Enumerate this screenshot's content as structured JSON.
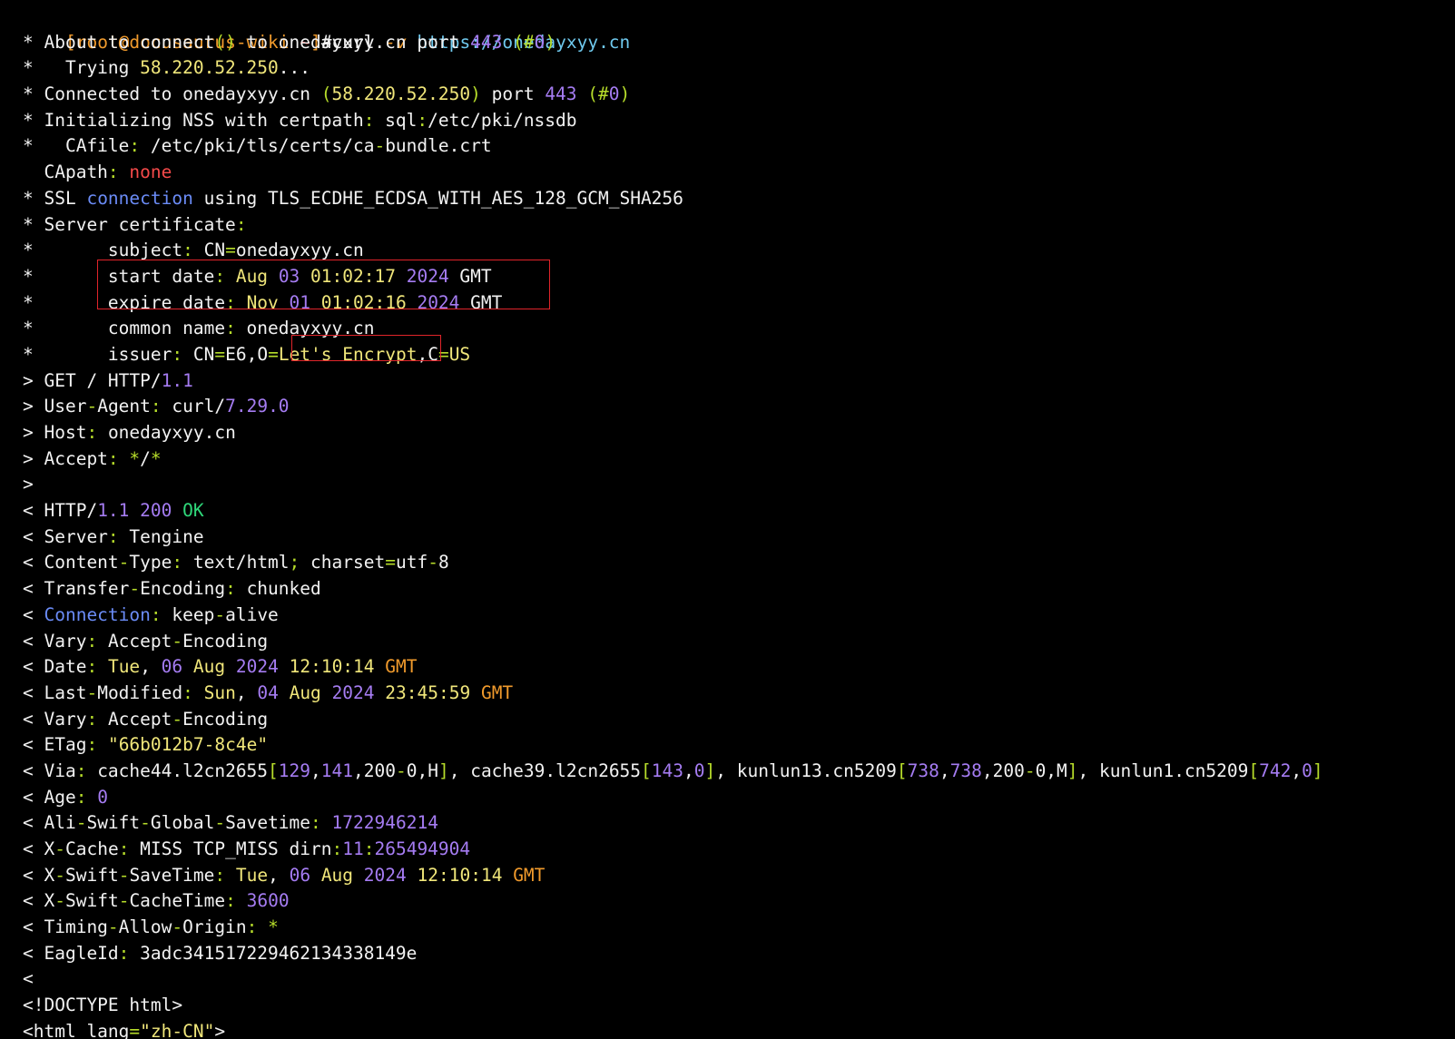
{
  "terminal": {
    "prompt": {
      "open_bracket": "[",
      "user_host": "root@docusaurus-wiki",
      "cwd": "~",
      "close_bracket": "]",
      "symbol": "#"
    },
    "command": {
      "name": "curl",
      "flag": "-v",
      "url": "https://onedayxyy.cn"
    },
    "colors": {
      "default": "#f2f2f2",
      "punctuation": "#b6dc2a",
      "number": "#a57cf2",
      "string": "#f0e67a",
      "keyword_red": "#f54a4a",
      "timezone": "#f09a2c",
      "url": "#6fc9ee",
      "keyword_blue": "#6b8cf7",
      "status_ok": "#2fd87a",
      "highlight_box": "#e0242a"
    },
    "lines": [
      [
        [
          "c-w",
          "* About to connect"
        ],
        [
          "c-g",
          "()"
        ],
        [
          "c-w",
          " to onedayxyy.cn port "
        ],
        [
          "c-p",
          "443"
        ],
        [
          "c-w",
          " "
        ],
        [
          "c-g",
          "(#"
        ],
        [
          "c-p",
          "0"
        ],
        [
          "c-g",
          ")"
        ]
      ],
      [
        [
          "c-w",
          "*   Trying "
        ],
        [
          "c-y",
          "58.220.52.250"
        ],
        [
          "c-w",
          "..."
        ]
      ],
      [
        [
          "c-w",
          "* Connected to onedayxyy.cn "
        ],
        [
          "c-g",
          "("
        ],
        [
          "c-y",
          "58.220.52.250"
        ],
        [
          "c-g",
          ")"
        ],
        [
          "c-w",
          " port "
        ],
        [
          "c-p",
          "443"
        ],
        [
          "c-w",
          " "
        ],
        [
          "c-g",
          "(#"
        ],
        [
          "c-p",
          "0"
        ],
        [
          "c-g",
          ")"
        ]
      ],
      [
        [
          "c-w",
          "* Initializing NSS with certpath"
        ],
        [
          "c-g",
          ":"
        ],
        [
          "c-w",
          " sql"
        ],
        [
          "c-g",
          ":"
        ],
        [
          "c-w",
          "/etc/pki/nssdb"
        ]
      ],
      [
        [
          "c-w",
          "*   CAfile"
        ],
        [
          "c-g",
          ":"
        ],
        [
          "c-w",
          " /etc/pki/tls/certs/ca"
        ],
        [
          "c-g",
          "-"
        ],
        [
          "c-w",
          "bundle.crt"
        ]
      ],
      [
        [
          "c-w",
          "  CApath"
        ],
        [
          "c-g",
          ":"
        ],
        [
          "c-w",
          " "
        ],
        [
          "c-r",
          "none"
        ]
      ],
      [
        [
          "c-w",
          "* SSL "
        ],
        [
          "c-b",
          "connection"
        ],
        [
          "c-w",
          " using TLS_ECDHE_ECDSA_WITH_AES_128_GCM_SHA256"
        ]
      ],
      [
        [
          "c-w",
          "* Server certificate"
        ],
        [
          "c-g",
          ":"
        ]
      ],
      [
        [
          "c-w",
          "*       subject"
        ],
        [
          "c-g",
          ":"
        ],
        [
          "c-w",
          " CN"
        ],
        [
          "c-g",
          "="
        ],
        [
          "c-w",
          "onedayxyy.cn"
        ]
      ],
      [
        [
          "c-w",
          "*       start date"
        ],
        [
          "c-g",
          ":"
        ],
        [
          "c-w",
          " "
        ],
        [
          "c-y",
          "Aug"
        ],
        [
          "c-w",
          " "
        ],
        [
          "c-p",
          "03"
        ],
        [
          "c-w",
          " "
        ],
        [
          "c-y",
          "01:02:17"
        ],
        [
          "c-w",
          " "
        ],
        [
          "c-p",
          "2024"
        ],
        [
          "c-w",
          " GMT"
        ]
      ],
      [
        [
          "c-w",
          "*       expire date"
        ],
        [
          "c-g",
          ":"
        ],
        [
          "c-w",
          " "
        ],
        [
          "c-y",
          "Nov"
        ],
        [
          "c-w",
          " "
        ],
        [
          "c-p",
          "01"
        ],
        [
          "c-w",
          " "
        ],
        [
          "c-y",
          "01:02:16"
        ],
        [
          "c-w",
          " "
        ],
        [
          "c-p",
          "2024"
        ],
        [
          "c-w",
          " GMT"
        ]
      ],
      [
        [
          "c-w",
          "*       common name"
        ],
        [
          "c-g",
          ":"
        ],
        [
          "c-w",
          " onedayxyy.cn"
        ]
      ],
      [
        [
          "c-w",
          "*       issuer"
        ],
        [
          "c-g",
          ":"
        ],
        [
          "c-w",
          " CN"
        ],
        [
          "c-g",
          "="
        ],
        [
          "c-w",
          "E6,O"
        ],
        [
          "c-g",
          "="
        ],
        [
          "c-y",
          "Let's Encrypt"
        ],
        [
          "c-w",
          ",C"
        ],
        [
          "c-g",
          "="
        ],
        [
          "c-y",
          "US"
        ]
      ],
      [
        [
          "c-w",
          "> GET / HTTP/"
        ],
        [
          "c-p",
          "1.1"
        ]
      ],
      [
        [
          "c-w",
          "> User"
        ],
        [
          "c-g",
          "-"
        ],
        [
          "c-w",
          "Agent"
        ],
        [
          "c-g",
          ":"
        ],
        [
          "c-w",
          " curl/"
        ],
        [
          "c-p",
          "7.29.0"
        ]
      ],
      [
        [
          "c-w",
          "> Host"
        ],
        [
          "c-g",
          ":"
        ],
        [
          "c-w",
          " onedayxyy.cn"
        ]
      ],
      [
        [
          "c-w",
          "> Accept"
        ],
        [
          "c-g",
          ":"
        ],
        [
          "c-w",
          " "
        ],
        [
          "c-g",
          "*"
        ],
        [
          "c-w",
          "/"
        ],
        [
          "c-g",
          "*"
        ]
      ],
      [
        [
          "c-w",
          ">"
        ]
      ],
      [
        [
          "c-w",
          "< HTTP/"
        ],
        [
          "c-p",
          "1.1"
        ],
        [
          "c-w",
          " "
        ],
        [
          "c-p",
          "200"
        ],
        [
          "c-w",
          " "
        ],
        [
          "c-n",
          "OK"
        ]
      ],
      [
        [
          "c-w",
          "< Server"
        ],
        [
          "c-g",
          ":"
        ],
        [
          "c-w",
          " Tengine"
        ]
      ],
      [
        [
          "c-w",
          "< Content"
        ],
        [
          "c-g",
          "-"
        ],
        [
          "c-w",
          "Type"
        ],
        [
          "c-g",
          ":"
        ],
        [
          "c-w",
          " text/html"
        ],
        [
          "c-g",
          ";"
        ],
        [
          "c-w",
          " charset"
        ],
        [
          "c-g",
          "="
        ],
        [
          "c-w",
          "utf"
        ],
        [
          "c-g",
          "-"
        ],
        [
          "c-w",
          "8"
        ]
      ],
      [
        [
          "c-w",
          "< Transfer"
        ],
        [
          "c-g",
          "-"
        ],
        [
          "c-w",
          "Encoding"
        ],
        [
          "c-g",
          ":"
        ],
        [
          "c-w",
          " chunked"
        ]
      ],
      [
        [
          "c-w",
          "< "
        ],
        [
          "c-b",
          "Connection"
        ],
        [
          "c-g",
          ":"
        ],
        [
          "c-w",
          " keep"
        ],
        [
          "c-g",
          "-"
        ],
        [
          "c-w",
          "alive"
        ]
      ],
      [
        [
          "c-w",
          "< Vary"
        ],
        [
          "c-g",
          ":"
        ],
        [
          "c-w",
          " Accept"
        ],
        [
          "c-g",
          "-"
        ],
        [
          "c-w",
          "Encoding"
        ]
      ],
      [
        [
          "c-w",
          "< Date"
        ],
        [
          "c-g",
          ":"
        ],
        [
          "c-w",
          " "
        ],
        [
          "c-y",
          "Tue"
        ],
        [
          "c-w",
          ", "
        ],
        [
          "c-p",
          "06"
        ],
        [
          "c-w",
          " "
        ],
        [
          "c-y",
          "Aug"
        ],
        [
          "c-w",
          " "
        ],
        [
          "c-p",
          "2024"
        ],
        [
          "c-w",
          " "
        ],
        [
          "c-y",
          "12:10:14"
        ],
        [
          "c-w",
          " "
        ],
        [
          "c-o",
          "GMT"
        ]
      ],
      [
        [
          "c-w",
          "< Last"
        ],
        [
          "c-g",
          "-"
        ],
        [
          "c-w",
          "Modified"
        ],
        [
          "c-g",
          ":"
        ],
        [
          "c-w",
          " "
        ],
        [
          "c-y",
          "Sun"
        ],
        [
          "c-w",
          ", "
        ],
        [
          "c-p",
          "04"
        ],
        [
          "c-w",
          " "
        ],
        [
          "c-y",
          "Aug"
        ],
        [
          "c-w",
          " "
        ],
        [
          "c-p",
          "2024"
        ],
        [
          "c-w",
          " "
        ],
        [
          "c-y",
          "23:45:59"
        ],
        [
          "c-w",
          " "
        ],
        [
          "c-o",
          "GMT"
        ]
      ],
      [
        [
          "c-w",
          "< Vary"
        ],
        [
          "c-g",
          ":"
        ],
        [
          "c-w",
          " Accept"
        ],
        [
          "c-g",
          "-"
        ],
        [
          "c-w",
          "Encoding"
        ]
      ],
      [
        [
          "c-w",
          "< ETag"
        ],
        [
          "c-g",
          ":"
        ],
        [
          "c-w",
          " "
        ],
        [
          "c-y",
          "\"66b012b7-8c4e\""
        ]
      ],
      [
        [
          "c-w",
          "< Via"
        ],
        [
          "c-g",
          ":"
        ],
        [
          "c-w",
          " cache44.l2cn2655"
        ],
        [
          "c-g",
          "["
        ],
        [
          "c-p",
          "129"
        ],
        [
          "c-w",
          ","
        ],
        [
          "c-p",
          "141"
        ],
        [
          "c-w",
          ",200"
        ],
        [
          "c-g",
          "-"
        ],
        [
          "c-w",
          "0,H"
        ],
        [
          "c-g",
          "]"
        ],
        [
          "c-w",
          ", cache39.l2cn2655"
        ],
        [
          "c-g",
          "["
        ],
        [
          "c-p",
          "143"
        ],
        [
          "c-w",
          ","
        ],
        [
          "c-p",
          "0"
        ],
        [
          "c-g",
          "]"
        ],
        [
          "c-w",
          ", kunlun13.cn5209"
        ],
        [
          "c-g",
          "["
        ],
        [
          "c-p",
          "738"
        ],
        [
          "c-w",
          ","
        ],
        [
          "c-p",
          "738"
        ],
        [
          "c-w",
          ",200"
        ],
        [
          "c-g",
          "-"
        ],
        [
          "c-w",
          "0,M"
        ],
        [
          "c-g",
          "]"
        ],
        [
          "c-w",
          ", kunlun1.cn5209"
        ],
        [
          "c-g",
          "["
        ],
        [
          "c-p",
          "742"
        ],
        [
          "c-w",
          ","
        ],
        [
          "c-p",
          "0"
        ],
        [
          "c-g",
          "]"
        ]
      ],
      [
        [
          "c-w",
          "< Age"
        ],
        [
          "c-g",
          ":"
        ],
        [
          "c-w",
          " "
        ],
        [
          "c-p",
          "0"
        ]
      ],
      [
        [
          "c-w",
          "< Ali"
        ],
        [
          "c-g",
          "-"
        ],
        [
          "c-w",
          "Swift"
        ],
        [
          "c-g",
          "-"
        ],
        [
          "c-w",
          "Global"
        ],
        [
          "c-g",
          "-"
        ],
        [
          "c-w",
          "Savetime"
        ],
        [
          "c-g",
          ":"
        ],
        [
          "c-w",
          " "
        ],
        [
          "c-p",
          "1722946214"
        ]
      ],
      [
        [
          "c-w",
          "< X"
        ],
        [
          "c-g",
          "-"
        ],
        [
          "c-w",
          "Cache"
        ],
        [
          "c-g",
          ":"
        ],
        [
          "c-w",
          " MISS TCP_MISS dirn"
        ],
        [
          "c-g",
          ":"
        ],
        [
          "c-p",
          "11"
        ],
        [
          "c-g",
          ":"
        ],
        [
          "c-p",
          "265494904"
        ]
      ],
      [
        [
          "c-w",
          "< X"
        ],
        [
          "c-g",
          "-"
        ],
        [
          "c-w",
          "Swift"
        ],
        [
          "c-g",
          "-"
        ],
        [
          "c-w",
          "SaveTime"
        ],
        [
          "c-g",
          ":"
        ],
        [
          "c-w",
          " "
        ],
        [
          "c-y",
          "Tue"
        ],
        [
          "c-w",
          ", "
        ],
        [
          "c-p",
          "06"
        ],
        [
          "c-w",
          " "
        ],
        [
          "c-y",
          "Aug"
        ],
        [
          "c-w",
          " "
        ],
        [
          "c-p",
          "2024"
        ],
        [
          "c-w",
          " "
        ],
        [
          "c-y",
          "12:10:14"
        ],
        [
          "c-w",
          " "
        ],
        [
          "c-o",
          "GMT"
        ]
      ],
      [
        [
          "c-w",
          "< X"
        ],
        [
          "c-g",
          "-"
        ],
        [
          "c-w",
          "Swift"
        ],
        [
          "c-g",
          "-"
        ],
        [
          "c-w",
          "CacheTime"
        ],
        [
          "c-g",
          ":"
        ],
        [
          "c-w",
          " "
        ],
        [
          "c-p",
          "3600"
        ]
      ],
      [
        [
          "c-w",
          "< Timing"
        ],
        [
          "c-g",
          "-"
        ],
        [
          "c-w",
          "Allow"
        ],
        [
          "c-g",
          "-"
        ],
        [
          "c-w",
          "Origin"
        ],
        [
          "c-g",
          ":"
        ],
        [
          "c-w",
          " "
        ],
        [
          "c-g",
          "*"
        ]
      ],
      [
        [
          "c-w",
          "< EagleId"
        ],
        [
          "c-g",
          ":"
        ],
        [
          "c-w",
          " 3adc3415172294621343381​49e"
        ]
      ],
      [
        [
          "c-w",
          "<"
        ]
      ],
      [
        [
          "c-w",
          "<!DOCTYPE html>"
        ]
      ],
      [
        [
          "c-w",
          "<html lang"
        ],
        [
          "c-g",
          "="
        ],
        [
          "c-y",
          "\"zh-CN\""
        ],
        [
          "c-w",
          ">"
        ]
      ]
    ]
  }
}
